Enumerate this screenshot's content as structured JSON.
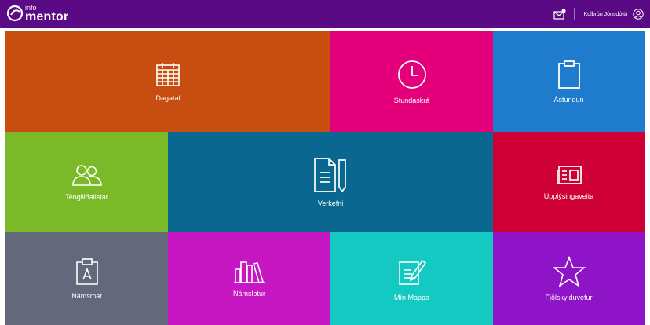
{
  "header": {
    "logo_small": "info",
    "logo_big": "mentor",
    "user_name": "Kolbrún Jónsdóttir"
  },
  "tiles": [
    {
      "label": "Dagatal",
      "icon": "calendar-icon",
      "color": "#c74e10"
    },
    {
      "label": "Stundaskrá",
      "icon": "clock-icon",
      "color": "#e4007a"
    },
    {
      "label": "Ástundun",
      "icon": "clipboard-icon",
      "color": "#1f7bcc"
    },
    {
      "label": "Tengiliðalistar",
      "icon": "contacts-icon",
      "color": "#7ab927"
    },
    {
      "label": "Verkefni",
      "icon": "document-pencil-icon",
      "color": "#0a6790"
    },
    {
      "label": "Upplýsingaveita",
      "icon": "newspaper-icon",
      "color": "#cf0036"
    },
    {
      "label": "Námsmat",
      "icon": "assessment-clipboard-icon",
      "color": "#63687a"
    },
    {
      "label": "Námslotur",
      "icon": "books-icon",
      "color": "#c717c2"
    },
    {
      "label": "Mín Mappa",
      "icon": "edit-note-icon",
      "color": "#13c9c2"
    },
    {
      "label": "Fjölskylduvefur",
      "icon": "star-icon",
      "color": "#8f13c7"
    }
  ]
}
